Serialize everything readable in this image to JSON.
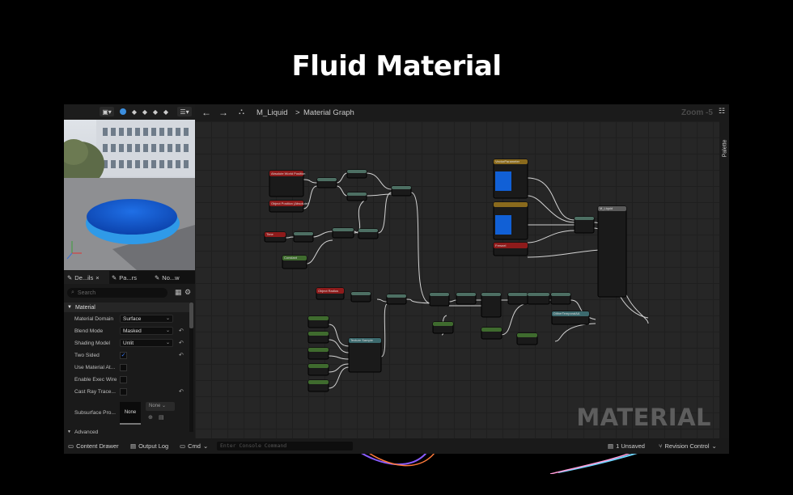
{
  "page_title": "Fluid Material",
  "graph_header": {
    "asset": "M_Liquid",
    "separator": ">",
    "view": "Material Graph",
    "zoom": "Zoom -5",
    "palette": "Palette"
  },
  "details": {
    "tabs": [
      {
        "label": "De...ils",
        "close": "×"
      },
      {
        "label": "Pa...rs"
      },
      {
        "label": "No...w"
      }
    ],
    "search_placeholder": "Search",
    "section": "Material",
    "rows": [
      {
        "label": "Material Domain",
        "value": "Surface"
      },
      {
        "label": "Blend Mode",
        "value": "Masked"
      },
      {
        "label": "Shading Model",
        "value": "Unlit"
      },
      {
        "label": "Two Sided",
        "checked": "✓"
      },
      {
        "label": "Use Material At..."
      },
      {
        "label": "Enable Exec Wire"
      },
      {
        "label": "Cast Ray Trace..."
      },
      {
        "label": "Subsurface Pro...",
        "value": "None",
        "drop": "None"
      }
    ],
    "advanced": "Advanced"
  },
  "graph": {
    "watermark": "MATERIAL",
    "node_titles": {
      "absolute_world_position": "Absolute World Position",
      "object_position": "Object Position (Absolute)",
      "time": "Time",
      "constant": "Constant",
      "object_radius": "Object Radius",
      "texture_sample": "Texture Sample",
      "vector_param": "VectorParameter",
      "fresnel": "Fresnel",
      "result": "M_Liquid",
      "dither": "DitherTemporalAA"
    },
    "result_pins": [
      "Base Color",
      "Metallic",
      "Specular",
      "Roughness",
      "Emissive Color",
      "Opacity",
      "Opacity Mask",
      "Normal",
      "World Position Offset",
      "Refraction",
      "Pixel Depth Offset"
    ]
  },
  "status_bar": {
    "content_drawer": "Content Drawer",
    "output_log": "Output Log",
    "cmd": "Cmd",
    "console_placeholder": "Enter Console Command",
    "unsaved": "1 Unsaved",
    "revision_control": "Revision Control"
  },
  "colors": {
    "background": "#000000",
    "accent_blue": "#1160d6",
    "node_red": "#8e1b1b",
    "node_green": "#3f6b2e",
    "node_gold": "#8a6a1d",
    "node_teal": "#3c6a6e"
  }
}
